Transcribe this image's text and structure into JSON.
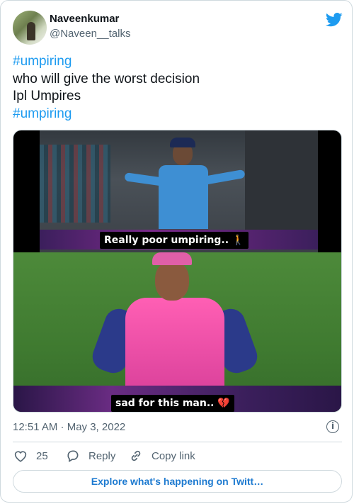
{
  "author": {
    "name": "Naveenkumar",
    "handle": "@Naveen__talks"
  },
  "tweet": {
    "lines": [
      {
        "text": "#umpiring",
        "hashtag": true
      },
      {
        "text": "who will give the worst decision",
        "hashtag": false
      },
      {
        "text": "Ipl Umpires",
        "hashtag": false
      },
      {
        "text": "#umpiring",
        "hashtag": true
      }
    ]
  },
  "media": {
    "caption_top": "Really poor umpiring.. 🚶",
    "caption_bottom": "sad for this man.. 💔"
  },
  "meta": {
    "timestamp": "12:51 AM · May 3, 2022",
    "info_icon": "info-icon"
  },
  "actions": {
    "like_count": "25",
    "reply_label": "Reply",
    "copy_label": "Copy link"
  },
  "explore_label": "Explore what's happening on Twitt…",
  "colors": {
    "accent": "#1d9bf0",
    "secondary_text": "#536471",
    "border": "#cfd9de"
  }
}
